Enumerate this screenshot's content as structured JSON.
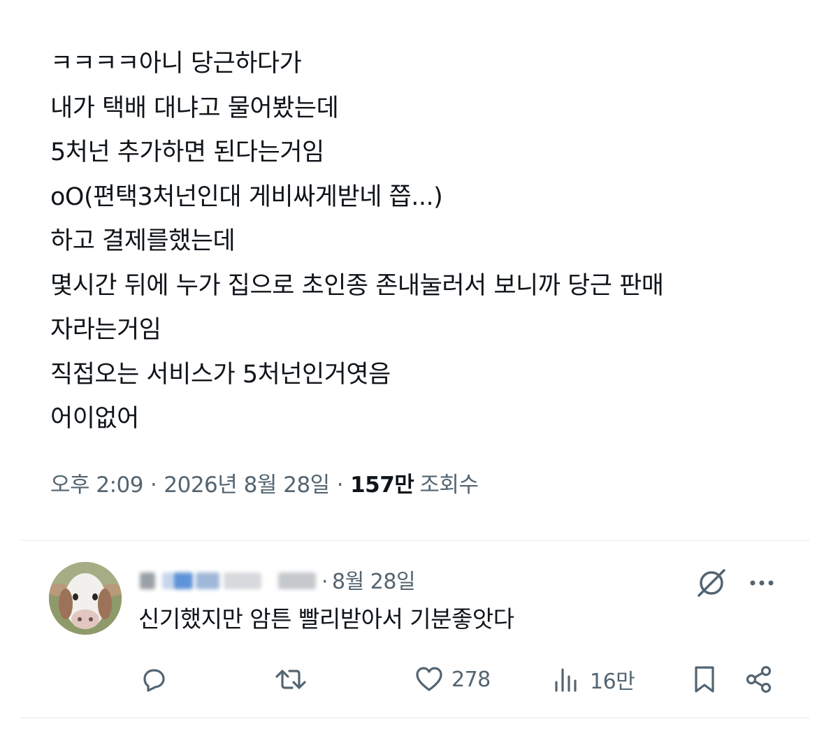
{
  "post": {
    "lines": [
      "ㅋㅋㅋㅋ아니 당근하다가",
      "내가 택배 대냐고 물어봤는데",
      "5처넌 추가하면 된다는거임",
      "oO(편택3처넌인대 게비싸게받네 쯥...)",
      "하고 결제를했는데",
      "몇시간 뒤에 누가 집으로 초인종 존내눌러서 보니까 당근 판매",
      "자라는거임",
      "직접오는 서비스가 5처넌인거엿음",
      "어이없어"
    ],
    "meta": {
      "time": "오후 2:09",
      "separator": "·",
      "date": "2026년 8월 28일",
      "views_count": "157만",
      "views_label": "조회수"
    }
  },
  "reply": {
    "date_separator": "·",
    "date": "8월 28일",
    "text": "신기했지만 암튼 빨리받아서 기분좋앗다",
    "actions": {
      "reply_count": "",
      "repost_count": "",
      "like_count": "278",
      "view_count": "16만"
    },
    "icons": {
      "reply": "reply-icon",
      "repost": "repost-icon",
      "like": "heart-icon",
      "views": "views-icon",
      "bookmark": "bookmark-icon",
      "share": "share-icon",
      "grok": "grok-icon",
      "more": "more-icon"
    }
  },
  "colors": {
    "text_primary": "#0f1419",
    "text_secondary": "#536471",
    "divider": "#eff3f4"
  }
}
